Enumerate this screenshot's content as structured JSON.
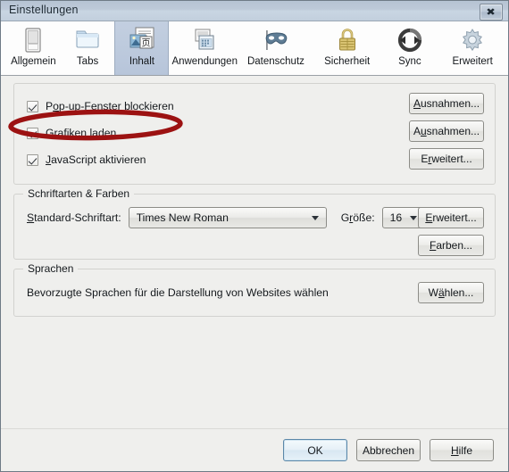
{
  "window": {
    "title": "Einstellungen",
    "close_label": "✕"
  },
  "tabs": [
    {
      "label": "Allgemein",
      "icon": "general-icon",
      "selected": false
    },
    {
      "label": "Tabs",
      "icon": "tabs-folder-icon",
      "selected": false
    },
    {
      "label": "Inhalt",
      "icon": "content-page-icon",
      "selected": true
    },
    {
      "label": "Anwendungen",
      "icon": "applications-icon",
      "selected": false
    },
    {
      "label": "Datenschutz",
      "icon": "privacy-mask-icon",
      "selected": false
    },
    {
      "label": "Sicherheit",
      "icon": "security-lock-icon",
      "selected": false
    },
    {
      "label": "Sync",
      "icon": "sync-icon",
      "selected": false
    },
    {
      "label": "Erweitert",
      "icon": "advanced-gear-icon",
      "selected": false
    }
  ],
  "content_panel": {
    "checkboxes": [
      {
        "label_pre": "P",
        "label_key": "o",
        "label_post": "p-up-Fenster blockieren",
        "checked": true
      },
      {
        "label_pre": "Grafiken ",
        "label_key": "l",
        "label_post": "aden",
        "checked": true
      },
      {
        "label_pre": "",
        "label_key": "J",
        "label_post": "avaScript aktivieren",
        "checked": true
      }
    ],
    "buttons": [
      {
        "pre": "",
        "key": "A",
        "post": "usnahmen..."
      },
      {
        "pre": "A",
        "key": "u",
        "post": "snahmen..."
      },
      {
        "pre": "E",
        "key": "r",
        "post": "weitert..."
      }
    ]
  },
  "fonts_panel": {
    "legend": "Schriftarten & Farben",
    "font_label_pre": "",
    "font_label_key": "S",
    "font_label_post": "tandard-Schriftart:",
    "font_value": "Times New Roman",
    "size_label_pre": "G",
    "size_label_key": "r",
    "size_label_post": "öße:",
    "size_value": "16",
    "buttons": [
      {
        "pre": "",
        "key": "E",
        "post": "rweitert..."
      },
      {
        "pre": "",
        "key": "F",
        "post": "arben..."
      }
    ]
  },
  "languages_panel": {
    "legend": "Sprachen",
    "description": "Bevorzugte Sprachen für die Darstellung von Websites wählen",
    "button": {
      "pre": "W",
      "key": "ä",
      "post": "hlen..."
    }
  },
  "footer": {
    "ok": "OK",
    "cancel": "Abbrechen",
    "help_pre": "",
    "help_key": "H",
    "help_post": "ilfe"
  },
  "annotation": {
    "shape": "red-ellipse-highlight",
    "color": "#9c1212",
    "target": "Grafiken laden"
  }
}
